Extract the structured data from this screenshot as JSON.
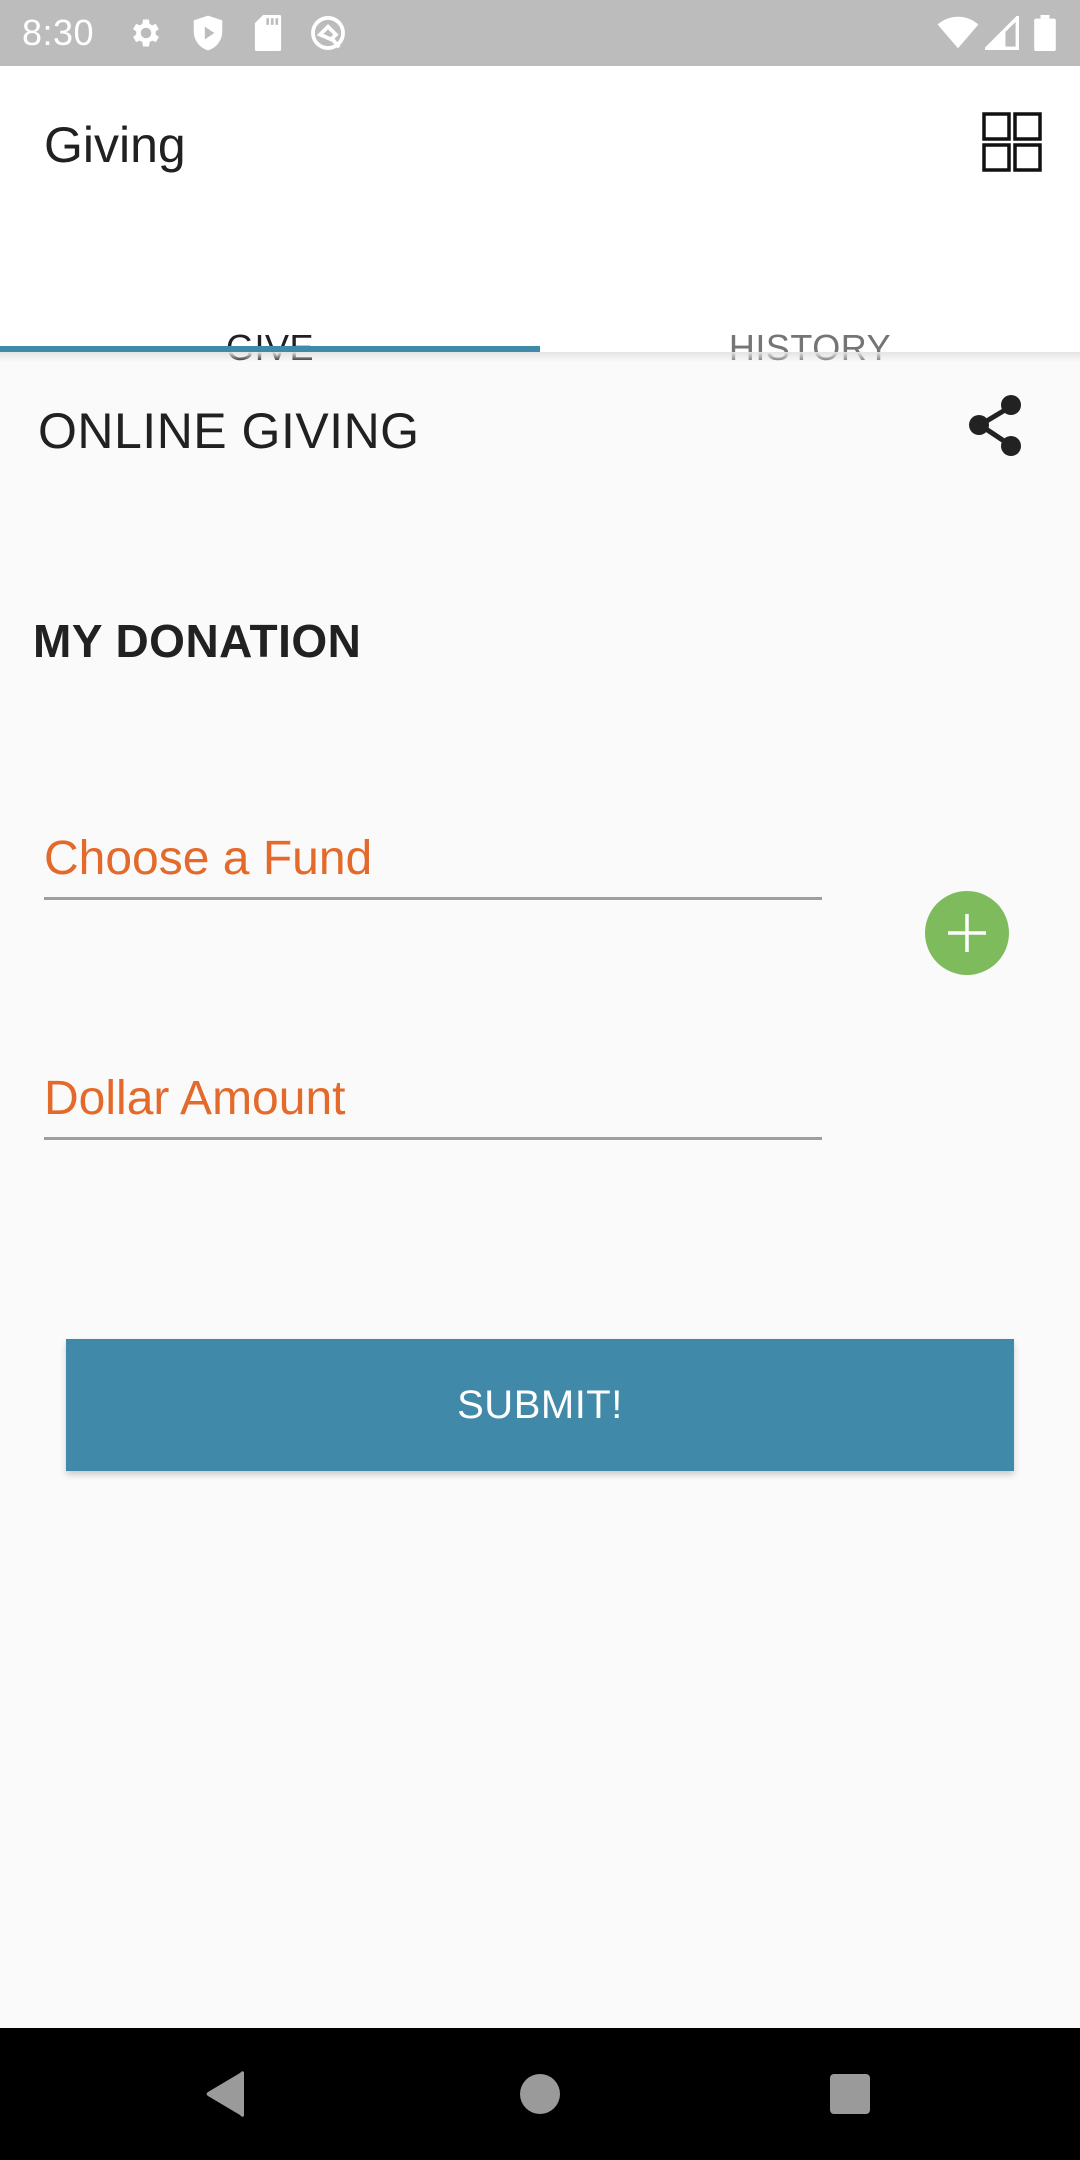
{
  "status_bar": {
    "time": "8:30",
    "left_icons": [
      "settings-icon",
      "shield-play-icon",
      "sd-card-icon",
      "q-logo-icon"
    ],
    "right_icons": [
      "wifi-icon",
      "signal-icon",
      "battery-icon"
    ]
  },
  "app_bar": {
    "title": "Giving",
    "action_icon": "grid-icon"
  },
  "tabs": [
    {
      "label": "GIVE",
      "active": true
    },
    {
      "label": "HISTORY",
      "active": false
    }
  ],
  "main": {
    "section_title": "ONLINE GIVING",
    "share_icon": "share-icon",
    "donation_heading": "MY DONATION",
    "fund_field": {
      "value": "",
      "placeholder": "Choose a Fund"
    },
    "amount_field": {
      "value": "",
      "placeholder": "Dollar Amount"
    },
    "add_fund_icon": "plus-icon",
    "submit_label": "SUBMIT!"
  },
  "colors": {
    "accent": "#4189a8",
    "placeholder": "#e36a2a",
    "fab": "#7dbb5c"
  },
  "nav_bar": {
    "buttons": [
      "back",
      "home",
      "recents"
    ]
  }
}
